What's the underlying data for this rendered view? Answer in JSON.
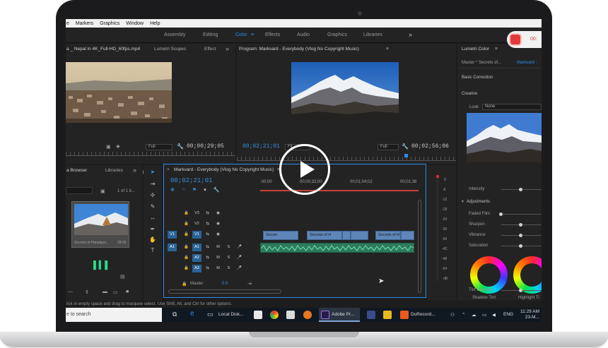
{
  "menu": [
    "e",
    "Markers",
    "Graphics",
    "Window",
    "Help"
  ],
  "workspaces": {
    "items": [
      "Assembly",
      "Editing",
      "Color",
      "Effects",
      "Audio",
      "Graphics",
      "Libraries"
    ],
    "active": "Color",
    "overflow": "»",
    "menu_glyph": "≡"
  },
  "recorder": {
    "label": "00:"
  },
  "source_panel": {
    "tabs": [
      "a _ Nepal in 4K_Full-HD_60fps.mp4",
      "Lumetri Scopes",
      "Effect"
    ],
    "overflow": "»",
    "fit": "Full",
    "timecode": "00;00;29;05"
  },
  "program_panel": {
    "title": "Program: Markvard - Everybody (Vlog No Copyright Music)",
    "menu_glyph": "≡",
    "timecode_current": "00;02;21;01",
    "fit": "Fit",
    "quality": "Full",
    "timecode_duration": "00;02;56;06"
  },
  "lumetri": {
    "title": "Lumetri Color",
    "menu_glyph": "≡",
    "master": "Master * Secrets of...",
    "target": "Markvard -",
    "basic_correction": "Basic Correction",
    "creative": "Creative",
    "look_label": "Look",
    "look_value": "None",
    "intensity": "Intensity",
    "adjustments": "Adjustments",
    "sliders": [
      "Faded Film",
      "Sharpen",
      "Vibrance",
      "Saturation"
    ],
    "shadow_tint": "Shadow Tint",
    "highlight_tint": "Highlight Ti",
    "tint_balance": "Tint Balance"
  },
  "media_panel": {
    "tabs": [
      "a Browser",
      "Libraries"
    ],
    "overflow": "»",
    "count": "1 of 1 it...",
    "clip_name": "Secrets of Himalaya...",
    "clip_duration": "28:00"
  },
  "timeline": {
    "close_glyph": "×",
    "title": "Markvard - Everybody (Vlog No Copyright Music)",
    "menu_glyph": "≡",
    "timecode": "00;02;21;01",
    "ruler": [
      ":00;00",
      "00;00;32;00",
      "00;01;04;02",
      "00;01;36"
    ],
    "video_tracks": [
      "V3",
      "V2",
      "V1"
    ],
    "audio_tracks": [
      "A1",
      "A2",
      "A3"
    ],
    "source_v": "V1",
    "source_a": "A1",
    "master_label": "Master",
    "master_value": "0.0",
    "clips": [
      "Secret",
      "Secrets of H",
      "Secrets of H"
    ],
    "mute": "M",
    "solo": "S"
  },
  "meters": [
    "0",
    "-6",
    "-12",
    "-18",
    "-24",
    "-30",
    "-36",
    "-42",
    "-48",
    "-54",
    "dB"
  ],
  "status_text": "lick in empty space and drag to marquee select. Use Shift, Alt, and Ctrl for other options.",
  "taskbar": {
    "search": "e to search",
    "local_disk": "Local Disk...",
    "premiere": "Adobe Pr...",
    "durecorder": "DuRecord...",
    "lang": "ENG",
    "time": "11:29 AM",
    "date": "23-M..."
  },
  "colors": {
    "accent": "#2d8ceb",
    "record": "#e23a3a",
    "video_clip": "#5f86b8",
    "audio_clip": "#2d7a5e",
    "active_track": "#2a6496"
  }
}
